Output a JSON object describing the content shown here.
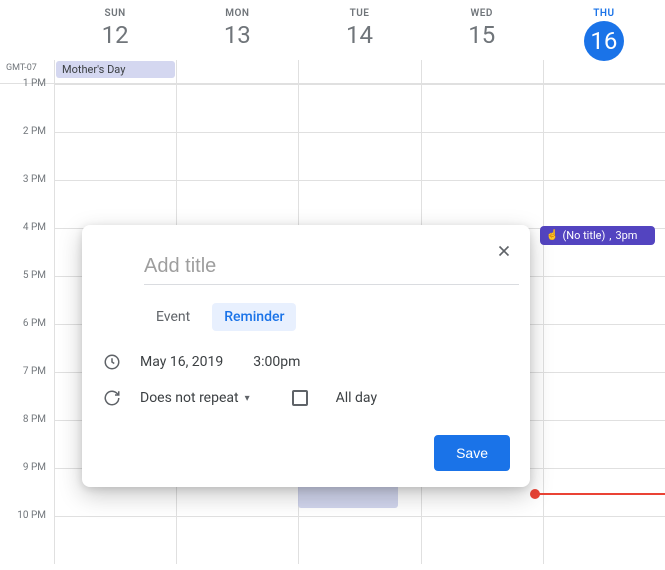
{
  "timezone": "GMT-07",
  "days": [
    {
      "label": "SUN",
      "number": "12",
      "today": false
    },
    {
      "label": "MON",
      "number": "13",
      "today": false
    },
    {
      "label": "TUE",
      "number": "14",
      "today": false
    },
    {
      "label": "WED",
      "number": "15",
      "today": false
    },
    {
      "label": "THU",
      "number": "16",
      "today": true
    }
  ],
  "hours": [
    "1 PM",
    "2 PM",
    "3 PM",
    "4 PM",
    "5 PM",
    "6 PM",
    "7 PM",
    "8 PM",
    "9 PM",
    "10 PM"
  ],
  "allday_event": {
    "title": "Mother's Day"
  },
  "event_chip": {
    "title": "(No title)",
    "time": "3pm"
  },
  "modal": {
    "title_placeholder": "Add title",
    "tabs": {
      "event": "Event",
      "reminder": "Reminder"
    },
    "date": "May 16, 2019",
    "time": "3:00pm",
    "repeat": "Does not repeat",
    "allday": "All day",
    "save": "Save"
  }
}
